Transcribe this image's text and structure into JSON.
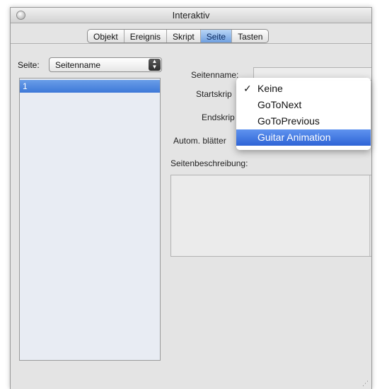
{
  "window": {
    "title": "Interaktiv"
  },
  "tabs": [
    {
      "label": "Objekt",
      "active": false
    },
    {
      "label": "Ereignis",
      "active": false
    },
    {
      "label": "Skript",
      "active": false
    },
    {
      "label": "Seite",
      "active": true
    },
    {
      "label": "Tasten",
      "active": false
    }
  ],
  "page_selector": {
    "label": "Seite:",
    "value": "Seitenname"
  },
  "page_list": {
    "items": [
      "1"
    ],
    "selected_index": 0
  },
  "form": {
    "name_label": "Seitenname:",
    "name_value": "",
    "start_label": "Startskrip",
    "end_label": "Endskrip",
    "auto_label": "Autom. blätter",
    "desc_label": "Seitenbeschreibung:",
    "desc_value": ""
  },
  "dropdown": {
    "items": [
      {
        "label": "Keine",
        "checked": true,
        "highlighted": false
      },
      {
        "label": "GoToNext",
        "checked": false,
        "highlighted": false
      },
      {
        "label": "GoToPrevious",
        "checked": false,
        "highlighted": false
      },
      {
        "label": "Guitar Animation",
        "checked": false,
        "highlighted": true
      }
    ],
    "check_glyph": "✓"
  },
  "colors": {
    "accent": "#3d78d8",
    "highlight": "#2e64d6"
  }
}
